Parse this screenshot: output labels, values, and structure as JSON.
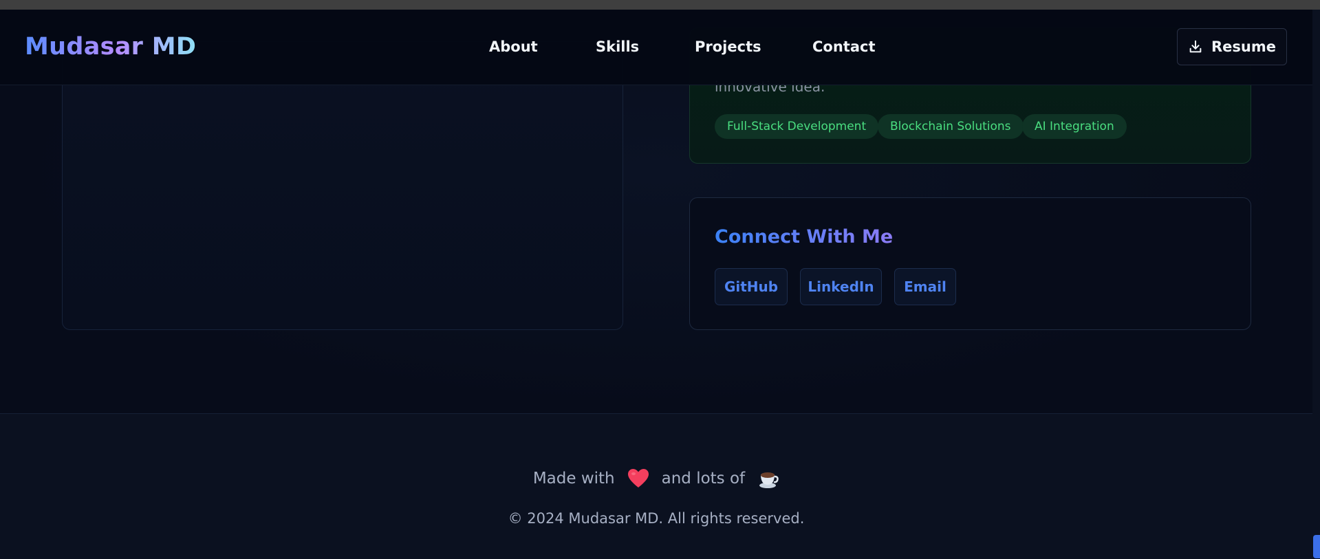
{
  "nav": {
    "brand": "Mudasar MD",
    "links": [
      "About",
      "Skills",
      "Projects",
      "Contact"
    ],
    "resume_label": "Resume"
  },
  "services": {
    "description_tail": "innovative idea.",
    "tags": [
      "Full-Stack Development",
      "Blockchain Solutions",
      "AI Integration"
    ]
  },
  "connect": {
    "title": "Connect With Me",
    "buttons": [
      "GitHub",
      "LinkedIn",
      "Email"
    ]
  },
  "footer": {
    "made_with": "Made with",
    "and_lots_of": "and lots of",
    "copyright": "© 2024 Mudasar MD. All rights reserved."
  },
  "icons": {
    "resume": "download-icon",
    "love": "heart-icon",
    "coffee": "coffee-icon"
  },
  "colors": {
    "background": "#080d1c",
    "accent_blue": "#4f83f1",
    "tag_green": "#4ade80"
  }
}
